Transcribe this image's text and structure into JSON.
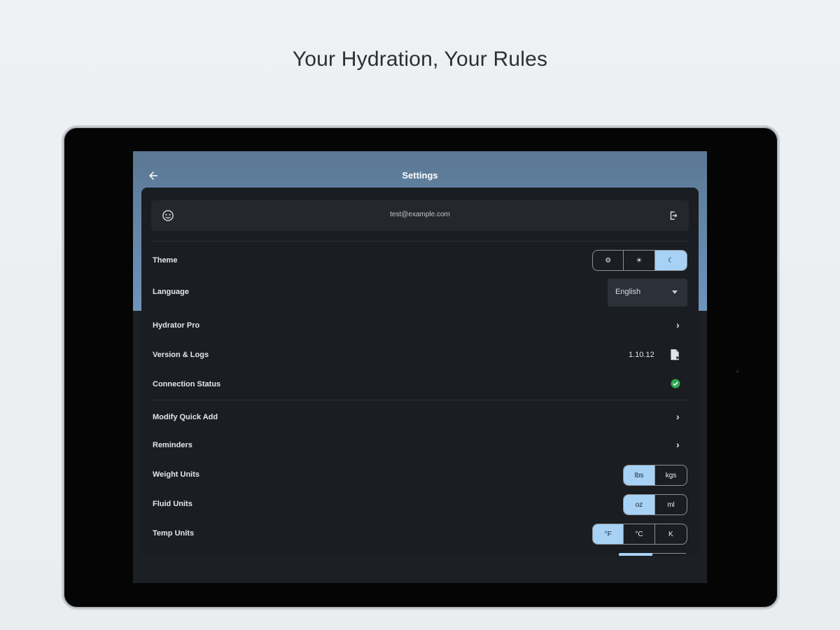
{
  "headline": "Your Hydration, Your Rules",
  "app": {
    "title": "Settings",
    "account": {
      "email": "test@example.com"
    },
    "theme": {
      "label": "Theme",
      "options": [
        "⚙",
        "☀",
        "☾"
      ],
      "selected": 2
    },
    "language": {
      "label": "Language",
      "value": "English"
    },
    "pro": {
      "label": "Hydrator Pro"
    },
    "version": {
      "label": "Version & Logs",
      "value": "1.10.12"
    },
    "connection": {
      "label": "Connection Status",
      "status": "connected"
    },
    "quick_add": {
      "label": "Modify Quick Add"
    },
    "reminders": {
      "label": "Reminders"
    },
    "weight_units": {
      "label": "Weight Units",
      "options": [
        "lbs",
        "kgs"
      ],
      "selected": 0
    },
    "fluid_units": {
      "label": "Fluid Units",
      "options": [
        "oz",
        "ml"
      ],
      "selected": 0
    },
    "temp_units": {
      "label": "Temp Units",
      "options": [
        "°F",
        "°C",
        "K"
      ],
      "selected": 0
    }
  },
  "colors": {
    "accent": "#a7d2f6",
    "hero_top": "#5b7893",
    "hero_bottom": "#6d94bc",
    "background": "#1c1f24",
    "status_ok": "#2fa84f"
  },
  "icons": {
    "back": "arrow-left-icon",
    "avatar": "face-icon",
    "logout": "logout-icon",
    "logs": "document-icon",
    "status": "check-circle-icon"
  }
}
